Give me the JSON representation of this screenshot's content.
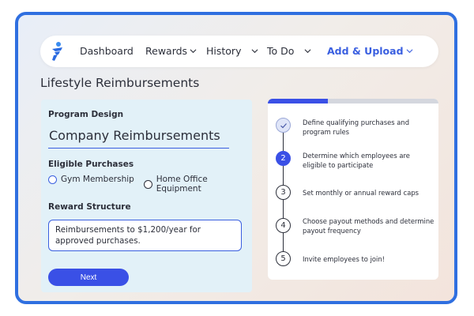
{
  "nav": {
    "items": [
      {
        "label": "Dashboard",
        "has_chevron": false
      },
      {
        "label": "Rewards",
        "has_chevron": true
      },
      {
        "label": "History",
        "has_chevron": true
      },
      {
        "label": "To Do",
        "has_chevron": true
      },
      {
        "label": "Add & Upload",
        "has_chevron": true,
        "active": true
      }
    ]
  },
  "page": {
    "title": "Lifestyle Reimbursements"
  },
  "form": {
    "program_design_label": "Program Design",
    "program_name": "Company Reimbursements",
    "eligible_label": "Eligible Purchases",
    "options": [
      "Gym Membership",
      "Home Office Equipment"
    ],
    "reward_label": "Reward Structure",
    "reward_text": "Reimbursements to $1,200/year for approved purchases.",
    "next_label": "Next"
  },
  "steps": {
    "progress_fraction": 0.35,
    "items": [
      {
        "number": "",
        "status": "done",
        "text": "Define qualifying purchases and program rules"
      },
      {
        "number": "2",
        "status": "current",
        "text": "Determine which employees are eligible to participate"
      },
      {
        "number": "3",
        "status": "todo",
        "text": "Set monthly or annual reward caps"
      },
      {
        "number": "4",
        "status": "todo",
        "text": "Choose payout methods and determine payout frequency"
      },
      {
        "number": "5",
        "status": "todo",
        "text": "Invite employees to join!"
      }
    ]
  },
  "colors": {
    "accent": "#3a50e6",
    "frame_border": "#2f6fe0",
    "panel_bg": "#e2f1f8",
    "text": "#2c2f3a"
  }
}
